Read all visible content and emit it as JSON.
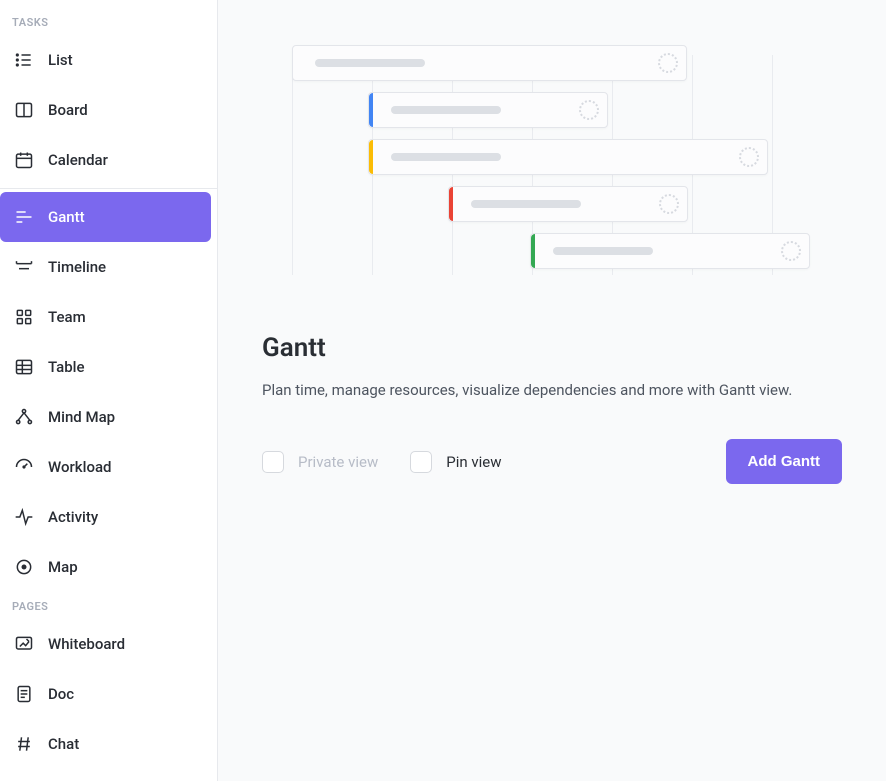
{
  "sidebar": {
    "sections": {
      "tasks_header": "TASKS",
      "pages_header": "PAGES"
    },
    "tasks": [
      {
        "label": "List"
      },
      {
        "label": "Board"
      },
      {
        "label": "Calendar"
      },
      {
        "label": "Gantt"
      },
      {
        "label": "Timeline"
      },
      {
        "label": "Team"
      },
      {
        "label": "Table"
      },
      {
        "label": "Mind Map"
      },
      {
        "label": "Workload"
      },
      {
        "label": "Activity"
      },
      {
        "label": "Map"
      }
    ],
    "pages": [
      {
        "label": "Whiteboard"
      },
      {
        "label": "Doc"
      },
      {
        "label": "Chat"
      }
    ],
    "active_index_tasks": 3
  },
  "main": {
    "title": "Gantt",
    "description": "Plan time, manage resources, visualize dependencies and more with Gantt view.",
    "private_label": "Private view",
    "pin_label": "Pin view",
    "add_button_label": "Add Gantt",
    "private_checked": false,
    "pin_checked": false,
    "private_enabled": false
  },
  "colors": {
    "accent": "#7B68EE",
    "bar_stripes": [
      "#4285F4",
      "#FBBC05",
      "#EA4335",
      "#34A853"
    ]
  }
}
